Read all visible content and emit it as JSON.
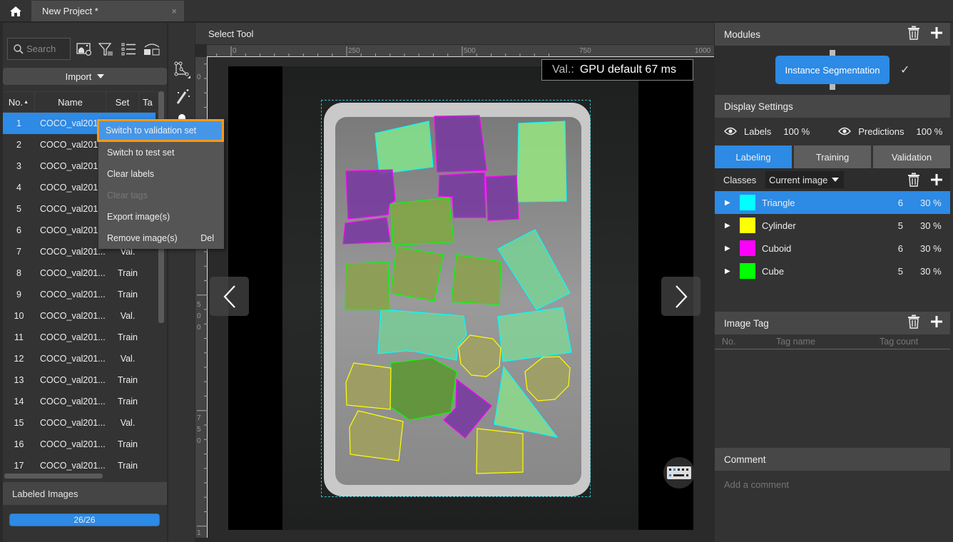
{
  "titlebar": {
    "home_icon": "home-icon",
    "tab_title": "New Project *",
    "close_label": "×"
  },
  "left_panel": {
    "search_placeholder": "Search",
    "toolbar_icons": [
      "image-settings-icon",
      "filter-icon",
      "list-icon",
      "layout-toggle-icon"
    ],
    "import_label": "Import",
    "table": {
      "headers": [
        "No.",
        "Name",
        "Set",
        "Ta"
      ],
      "rows": [
        {
          "no": "1",
          "name": "COCO_val201",
          "set": ""
        },
        {
          "no": "2",
          "name": "COCO_val201...",
          "set": ""
        },
        {
          "no": "3",
          "name": "COCO_val201...",
          "set": ""
        },
        {
          "no": "4",
          "name": "COCO_val201...",
          "set": ""
        },
        {
          "no": "5",
          "name": "COCO_val201...",
          "set": ""
        },
        {
          "no": "6",
          "name": "COCO_val201...",
          "set": ""
        },
        {
          "no": "7",
          "name": "COCO_val201...",
          "set": "Val."
        },
        {
          "no": "8",
          "name": "COCO_val201...",
          "set": "Train"
        },
        {
          "no": "9",
          "name": "COCO_val201...",
          "set": "Train"
        },
        {
          "no": "10",
          "name": "COCO_val201...",
          "set": "Val."
        },
        {
          "no": "11",
          "name": "COCO_val201...",
          "set": "Train"
        },
        {
          "no": "12",
          "name": "COCO_val201...",
          "set": "Val."
        },
        {
          "no": "13",
          "name": "COCO_val201...",
          "set": "Train"
        },
        {
          "no": "14",
          "name": "COCO_val201...",
          "set": "Train"
        },
        {
          "no": "15",
          "name": "COCO_val201...",
          "set": "Val."
        },
        {
          "no": "16",
          "name": "COCO_val201...",
          "set": "Train"
        },
        {
          "no": "17",
          "name": "COCO_val201...",
          "set": "Train"
        }
      ]
    },
    "labeled_images_title": "Labeled Images",
    "labeled_progress_text": "26/26",
    "labeled_progress_fraction": 1.0
  },
  "context_menu": {
    "items": [
      {
        "label": "Switch to validation set",
        "shortcut": "",
        "state": "highlighted"
      },
      {
        "label": "Switch to test set",
        "shortcut": "",
        "state": "normal"
      },
      {
        "label": "Clear labels",
        "shortcut": "",
        "state": "normal"
      },
      {
        "label": "Clear tags",
        "shortcut": "",
        "state": "disabled"
      },
      {
        "label": "Export image(s)",
        "shortcut": "",
        "state": "normal"
      },
      {
        "label": "Remove image(s)",
        "shortcut": "Del",
        "state": "normal"
      }
    ]
  },
  "canvas": {
    "tool_title": "Select Tool",
    "tools": [
      "polygon-tool-icon",
      "magic-wand-icon",
      "brush-icon"
    ],
    "ruler_top_labels": [
      "0",
      "250",
      "500",
      "750",
      "1000"
    ],
    "ruler_left_labels": [
      "0",
      "500",
      "750",
      "1"
    ],
    "inference_label": "Val.:",
    "inference_value": "GPU default 67 ms",
    "prev_icon": "chevron-left-icon",
    "next_icon": "chevron-right-icon",
    "keyboard_icon": "keyboard-icon"
  },
  "right_panel": {
    "modules_title": "Modules",
    "module_name": "Instance Segmentation",
    "module_status_icon": "check-icon",
    "display_settings_title": "Display Settings",
    "labels_label": "Labels",
    "labels_opacity": "100 %",
    "predictions_label": "Predictions",
    "predictions_opacity": "100 %",
    "tabs": [
      "Labeling",
      "Training",
      "Validation"
    ],
    "active_tab": "Labeling",
    "classes_label": "Classes",
    "classes_filter": "Current image",
    "classes": [
      {
        "name": "Triangle",
        "color": "#00ffff",
        "count": "6",
        "percent": "30 %"
      },
      {
        "name": "Cylinder",
        "color": "#ffff00",
        "count": "5",
        "percent": "30 %"
      },
      {
        "name": "Cuboid",
        "color": "#ff00ff",
        "count": "6",
        "percent": "30 %"
      },
      {
        "name": "Cube",
        "color": "#00ff00",
        "count": "5",
        "percent": "30 %"
      }
    ],
    "image_tag_title": "Image Tag",
    "tag_columns": [
      "No.",
      "Tag name",
      "Tag count"
    ],
    "comment_title": "Comment",
    "comment_placeholder": "Add a comment"
  },
  "colors": {
    "accent": "#2d8ae5",
    "highlight_border": "#f39a1c"
  }
}
